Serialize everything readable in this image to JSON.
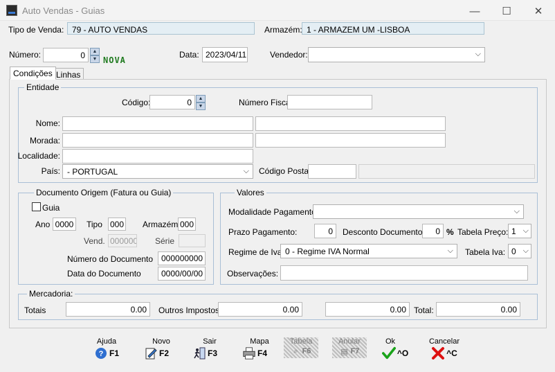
{
  "window": {
    "title": "Auto Vendas - Guias"
  },
  "header": {
    "tipo_venda_label": "Tipo de Venda:",
    "tipo_venda_value": "79 - AUTO VENDAS",
    "armazem_label": "Armazém:",
    "armazem_value": "1 - ARMAZEM UM -LISBOA",
    "numero_label": "Número:",
    "numero_value": "0",
    "nova_badge": "NOVA",
    "data_label": "Data:",
    "data_value": "2023/04/11",
    "vendedor_label": "Vendedor:",
    "vendedor_value": ""
  },
  "tabs": [
    {
      "label": "Condições"
    },
    {
      "label": "Linhas"
    }
  ],
  "entidade": {
    "legend": "Entidade",
    "codigo_label": "Código:",
    "codigo_value": "0",
    "numero_fiscal_label": "Número Fiscal:",
    "numero_fiscal_value": "",
    "nome_label": "Nome:",
    "morada_label": "Morada:",
    "localidade_label": "Localidade:",
    "pais_label": "País:",
    "pais_value": "- PORTUGAL",
    "codigo_postal_label": "Código Postal:"
  },
  "documento_origem": {
    "legend": "Documento Origem (Fatura ou Guia)",
    "guia_label": "Guia",
    "guia_checked": false,
    "ano_label": "Ano",
    "ano_value": "0000",
    "tipo_label": "Tipo",
    "tipo_value": "000",
    "armazem_label": "Armazém",
    "armazem_value": "000",
    "vend_label": "Vend.",
    "vend_value": "000000",
    "serie_label": "Série",
    "serie_value": "",
    "numero_documento_label": "Número do Documento",
    "numero_documento_value": "000000000",
    "data_documento_label": "Data do Documento",
    "data_documento_value": "0000/00/00"
  },
  "valores": {
    "legend": "Valores",
    "modalidade_label": "Modalidade Pagamento:",
    "modalidade_value": "",
    "prazo_label": "Prazo Pagamento:",
    "prazo_value": "0",
    "desconto_label": "Desconto Documento:",
    "desconto_value": "0",
    "percent_symbol": "%",
    "tabela_preco_label": "Tabela Preço:",
    "tabela_preco_value": "1",
    "regime_label": "Regime de Iva:",
    "regime_value": "0 - Regime IVA Normal",
    "tabela_iva_label": "Tabela Iva:",
    "tabela_iva_value": "0",
    "observacoes_label": "Observações:",
    "observacoes_value": ""
  },
  "mercadoria": {
    "legend": "Mercadoria:",
    "totais_label": "Totais",
    "totais_value": "0.00",
    "outros_impostos_label": "Outros Impostos:",
    "outros_impostos_value": "0.00",
    "third_value": "0.00",
    "total_label": "Total:",
    "total_value": "0.00"
  },
  "toolbar": [
    {
      "label": "Ajuda",
      "key": "F1",
      "icon": "help-icon"
    },
    {
      "label": "Novo",
      "key": "F2",
      "icon": "new-document-icon"
    },
    {
      "label": "Sair",
      "key": "F3",
      "icon": "exit-icon"
    },
    {
      "label": "Mapa",
      "key": "F4",
      "icon": "printer-icon"
    },
    {
      "label": "Tabela",
      "key": "F6",
      "icon": "table-search-icon",
      "disabled": true
    },
    {
      "label": "Anular",
      "key": "F7",
      "icon": "cancel-document-icon",
      "disabled": true
    },
    {
      "label": "Ok",
      "key": "^O",
      "icon": "checkmark-icon"
    },
    {
      "label": "Cancelar",
      "key": "^C",
      "icon": "x-icon"
    }
  ]
}
